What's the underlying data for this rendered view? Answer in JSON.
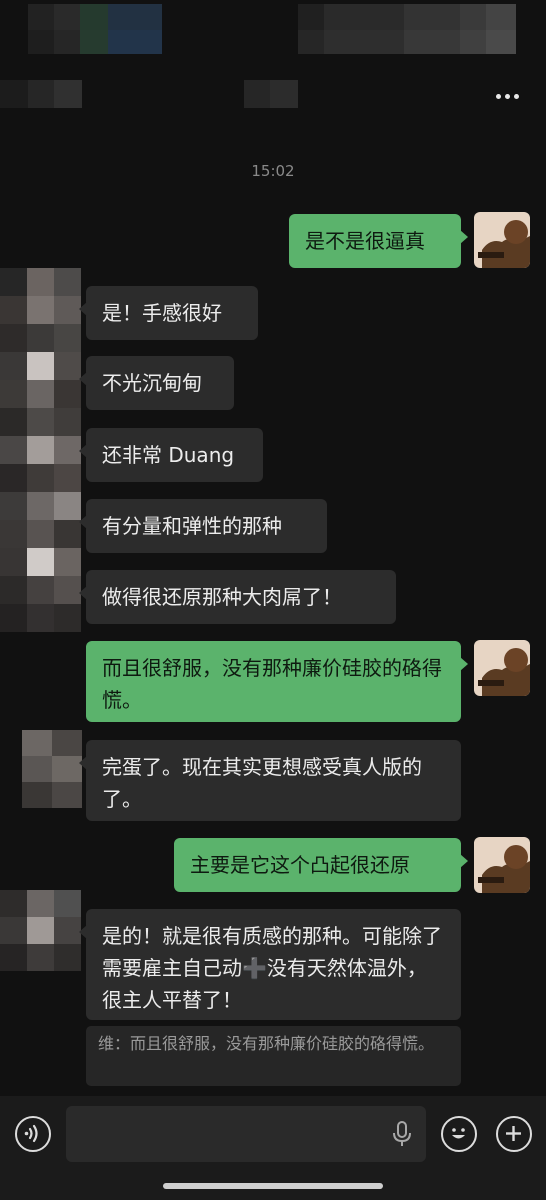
{
  "conversation": {
    "timestamp": "15:02"
  },
  "messages": [
    {
      "side": "out",
      "text": "是不是很逼真"
    },
    {
      "side": "in",
      "text": "是！手感很好"
    },
    {
      "side": "in",
      "text": "不光沉甸甸"
    },
    {
      "side": "in",
      "text": "还非常 Duang"
    },
    {
      "side": "in",
      "text": "有分量和弹性的那种"
    },
    {
      "side": "in",
      "text": "做得很还原那种大肉屌了！"
    },
    {
      "side": "out",
      "text": "而且很舒服，没有那种廉价硅胶的硌得慌。"
    },
    {
      "side": "in",
      "text": "完蛋了。现在其实更想感受真人版的了。"
    },
    {
      "side": "out",
      "text": "主要是它这个凸起很还原"
    },
    {
      "side": "in",
      "text": "是的！就是很有质感的那种。可能除了需要雇主自己动➕没有天然体温外，很主人平替了！"
    }
  ],
  "quote": {
    "text": "维：而且很舒服，没有那种廉价硅胶的硌得慌。"
  },
  "icons": {
    "more": "more-dots-icon",
    "voice": "voice-toggle-icon",
    "mic": "microphone-icon",
    "emoji": "emoji-icon",
    "add": "plus-icon"
  },
  "colors": {
    "background": "#111111",
    "incoming_bubble": "#2c2c2c",
    "outgoing_bubble": "#5bb36c"
  }
}
